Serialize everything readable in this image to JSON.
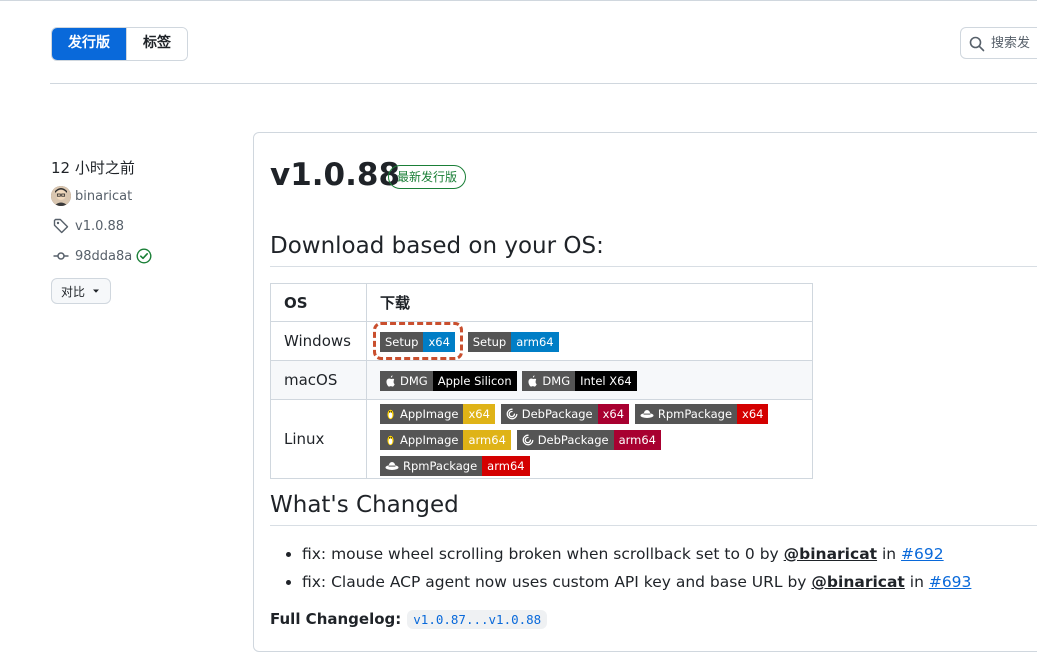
{
  "tabs": {
    "releases": "发行版",
    "tags": "标签"
  },
  "search": {
    "placeholder": "搜索发"
  },
  "sidebar": {
    "date": "12 小时之前",
    "author": "binaricat",
    "tag": "v1.0.88",
    "commit": "98dda8a",
    "compare_label": "对比"
  },
  "release": {
    "title": "v1.0.88",
    "latest_badge": "最新发行版",
    "download_heading": "Download based on your OS:",
    "whats_changed_heading": "What's Changed",
    "table": {
      "headers": [
        "OS",
        "下载"
      ],
      "rows": {
        "windows": "Windows",
        "macos": "macOS",
        "linux": "Linux"
      },
      "windows_badges": [
        {
          "left": "Setup",
          "right": "x64",
          "color": "#007ec6"
        },
        {
          "left": "Setup",
          "right": "arm64",
          "color": "#007ec6"
        }
      ],
      "mac_badges": [
        {
          "left": "DMG",
          "right": "Apple Silicon",
          "color": "#000000"
        },
        {
          "left": "DMG",
          "right": "Intel X64",
          "color": "#000000"
        }
      ],
      "linux_badges_x64": [
        {
          "left": "AppImage",
          "right": "x64",
          "color": "#dfb317"
        },
        {
          "left": "DebPackage",
          "right": "x64",
          "color": "#a80030"
        },
        {
          "left": "RpmPackage",
          "right": "x64",
          "color": "#d40000"
        }
      ],
      "linux_badges_arm64": [
        {
          "left": "AppImage",
          "right": "arm64",
          "color": "#dfb317"
        },
        {
          "left": "DebPackage",
          "right": "arm64",
          "color": "#a80030"
        },
        {
          "left": "RpmPackage",
          "right": "arm64",
          "color": "#d40000"
        }
      ]
    },
    "changes": [
      {
        "text": "fix: mouse wheel scrolling broken when scrollback set to 0 by ",
        "author": "@binaricat",
        "in": " in ",
        "pr": "#692"
      },
      {
        "text": "fix: Claude ACP agent now uses custom API key and base URL by ",
        "author": "@binaricat",
        "in": " in ",
        "pr": "#693"
      }
    ],
    "full_changelog_label": "Full Changelog:",
    "full_changelog_value": "v1.0.87...v1.0.88"
  }
}
